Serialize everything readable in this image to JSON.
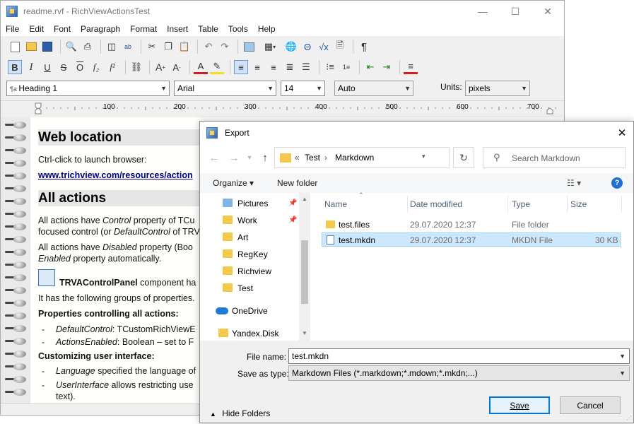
{
  "app": {
    "title": "readme.rvf - RichViewActionsTest",
    "window_controls": {
      "minimize": "—",
      "maximize": "☐",
      "close": "✕"
    }
  },
  "menu": [
    "File",
    "Edit",
    "Font",
    "Paragraph",
    "Format",
    "Insert",
    "Table",
    "Tools",
    "Help"
  ],
  "toolbar": {
    "style_combo": "Heading 1",
    "font_combo": "Arial",
    "size_combo": "14",
    "color_combo": "Auto",
    "units_label": "Units:",
    "units_combo": "pixels",
    "bold_label": "B",
    "italic_label": "I",
    "underline_label": "U",
    "strike_label": "S",
    "overline_label": "O",
    "subscript_label": "f₂",
    "superscript_label": "f²",
    "pilcrow_label": "¶"
  },
  "ruler": {
    "ticks": [
      "100",
      "200",
      "300",
      "400",
      "500",
      "600",
      "700"
    ]
  },
  "document": {
    "heading1": "Web location",
    "line1": "Ctrl-click to launch browser:",
    "link1": "www.trichview.com/resources/action",
    "heading2": "All actions",
    "p1a_pre": "All actions have ",
    "p1a_em": "Control",
    "p1a_post": " property of TCu",
    "p1b_pre": "focused control (or ",
    "p1b_em": "DefaultControl",
    "p1b_post": " of TRV",
    "p2a_pre": "All actions have ",
    "p2a_em": "Disabled",
    "p2a_post": " property (Boo",
    "p2b_em": "Enabled",
    "p2b_post": " property automatically.",
    "p3_bold": "TRVAControlPanel",
    "p3_post": " component ha",
    "p4": "It has the following groups of properties.",
    "p5_bold": "Properties controlling all actions:",
    "b1_em": "DefaultControl",
    "b1_post": ": TCustomRichViewE",
    "b2_em": "ActionsEnabled",
    "b2_post": ": Boolean – set to F",
    "p6_bold": "Customizing user interface:",
    "b3_em": "Language",
    "b3_post": " specified the language of",
    "b4_em": "UserInterface",
    "b4_post": " allows restricting use",
    "b4_cont": "text).",
    "dash": "-"
  },
  "dialog": {
    "title": "Export",
    "close": "✕",
    "breadcrumb": {
      "prefix": "«",
      "seg1": "Test",
      "sep": "›",
      "seg2": "Markdown"
    },
    "search_placeholder": "Search Markdown",
    "organize": "Organize ▾",
    "new_folder": "New folder",
    "help": "?",
    "nav_items": [
      {
        "label": "Pictures",
        "pinned": true
      },
      {
        "label": "Work",
        "pinned": true
      },
      {
        "label": "Art",
        "pinned": false
      },
      {
        "label": "RegKey",
        "pinned": false
      },
      {
        "label": "Richview",
        "pinned": false
      },
      {
        "label": "Test",
        "pinned": false
      },
      {
        "label": "OneDrive",
        "pinned": false
      },
      {
        "label": "Yandex.Disk",
        "pinned": false
      }
    ],
    "columns": {
      "name": "Name",
      "date": "Date modified",
      "type": "Type",
      "size": "Size"
    },
    "files": [
      {
        "name": "test.files",
        "date": "29.07.2020 12:37",
        "type": "File folder",
        "size": "",
        "kind": "folder",
        "selected": false
      },
      {
        "name": "test.mkdn",
        "date": "29.07.2020 12:37",
        "type": "MKDN File",
        "size": "30 KB",
        "kind": "file",
        "selected": true
      }
    ],
    "filename_label": "File name:",
    "filename_value": "test.mkdn",
    "savetype_label": "Save as type:",
    "savetype_value": "Markdown Files (*.markdown;*.mdown;*.mkdn;...)",
    "hide_folders": "Hide Folders",
    "save_button": "Save",
    "cancel_button": "Cancel"
  }
}
